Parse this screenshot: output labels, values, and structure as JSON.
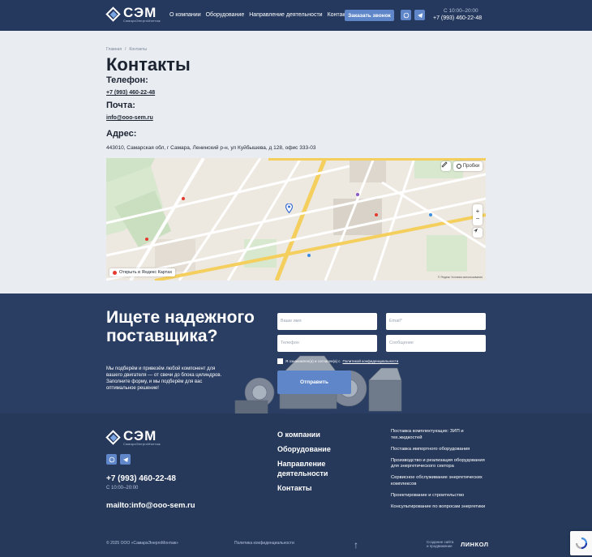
{
  "header": {
    "logo_name": "СЭМ",
    "logo_sub": "СамараЭнергоМонтаж",
    "nav": [
      "О компании",
      "Оборудование",
      "Направление деятельности",
      "Контакты"
    ],
    "cta": "Заказать звонок",
    "hours": "С 10:00–20:00",
    "phone": "+7 (993) 460-22-48"
  },
  "breadcrumbs": [
    "Главная",
    "/",
    "Контакты"
  ],
  "page": {
    "title": "Контакты",
    "phone_label": "Телефон:",
    "phone": "+7 (993) 460-22-48",
    "mail_label": "Почта:",
    "mail": "info@ooo-sem.ru",
    "address_label": "Адрес:",
    "address": "443010, Самарская обл, г Самара, Ленинский р-н, ул Куйбышева, д 128, офис 333-03"
  },
  "map": {
    "traffic": "Пробки",
    "open_link": "Открыть в Яндекс Картах",
    "copyright": "© Яндекс  Условия использования"
  },
  "request": {
    "title": "Ищете надежного поставщика?",
    "text": "Мы подберём и привезём любой компонент для вашего двигателя — от свечи до блока цилиндров. Заполните форму, и мы подберём для вас оптимальное решение!",
    "name_placeholder": "Ваше имя",
    "email_placeholder": "Email*",
    "phone_placeholder": "Телефон",
    "message_placeholder": "Сообщение",
    "agree_text": "Я ознакомлен(а) и согласен(а) с",
    "agree_link": "Политикой конфиденциальности",
    "submit": "Отправить"
  },
  "footer": {
    "logo_name": "СЭМ",
    "logo_sub": "СамараЭнергоМонтаж",
    "phone": "+7 (993) 460-22-48",
    "hours": "С 10:00–20:00",
    "mail": "mailto:info@ooo-sem.ru",
    "nav": [
      "О компании",
      "Оборудование",
      "Направление деятельности",
      "Контакты"
    ],
    "services": [
      "Поставка комплектующих: ЗИП и тех.жидкостей",
      "Поставка импортного оборудования",
      "Производство и реализация оборудования для энергетического сектора",
      "Сервисное обслуживание энергетических комплексов",
      "Проектирование и строительство",
      "Консультирование по вопросам энергетики"
    ],
    "copyright": "© 2025 ООО «СамараЭнергоМонтаж»",
    "privacy": "Политика конфиденциальности",
    "made_by_1": "Создание сайта",
    "made_by_2": "и продвижение",
    "studio": "ЛИНКОЛ"
  },
  "colors": {
    "header_bg": "#25395e",
    "accent": "#5e86c8",
    "page_bg": "#e9edf2"
  }
}
